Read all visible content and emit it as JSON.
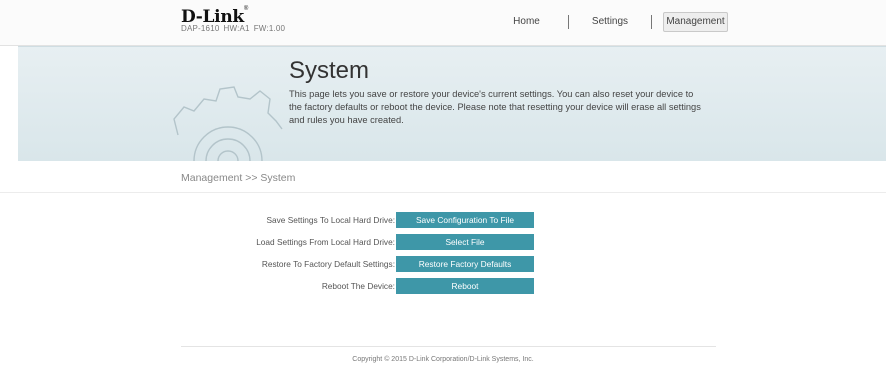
{
  "brand": {
    "logo_text": "D-Link",
    "logo_mark": "®",
    "model": "DAP-1610",
    "hw": "HW:A1",
    "fw": "FW:1.00"
  },
  "nav": {
    "home": "Home",
    "settings": "Settings",
    "management": "Management",
    "active": "Management"
  },
  "banner": {
    "title": "System",
    "description": "This page lets you save or restore your device's current settings. You can also reset your device to the factory defaults or reboot the device. Please note that resetting your device will erase all settings and rules you have created.",
    "icon": "gear-icon"
  },
  "breadcrumb": "Management >> System",
  "rows": [
    {
      "label": "Save Settings To Local Hard Drive:",
      "button": "Save Configuration To File"
    },
    {
      "label": "Load Settings From Local Hard Drive:",
      "button": "Select File"
    },
    {
      "label": "Restore To Factory Default Settings:",
      "button": "Restore Factory Defaults"
    },
    {
      "label": "Reboot The Device:",
      "button": "Reboot"
    }
  ],
  "footer": {
    "copyright": "Copyright © 2015 D-Link Corporation/D-Link Systems, Inc."
  },
  "colors": {
    "accent_button": "#3e97a8",
    "banner_bg": "#dde9ed"
  }
}
